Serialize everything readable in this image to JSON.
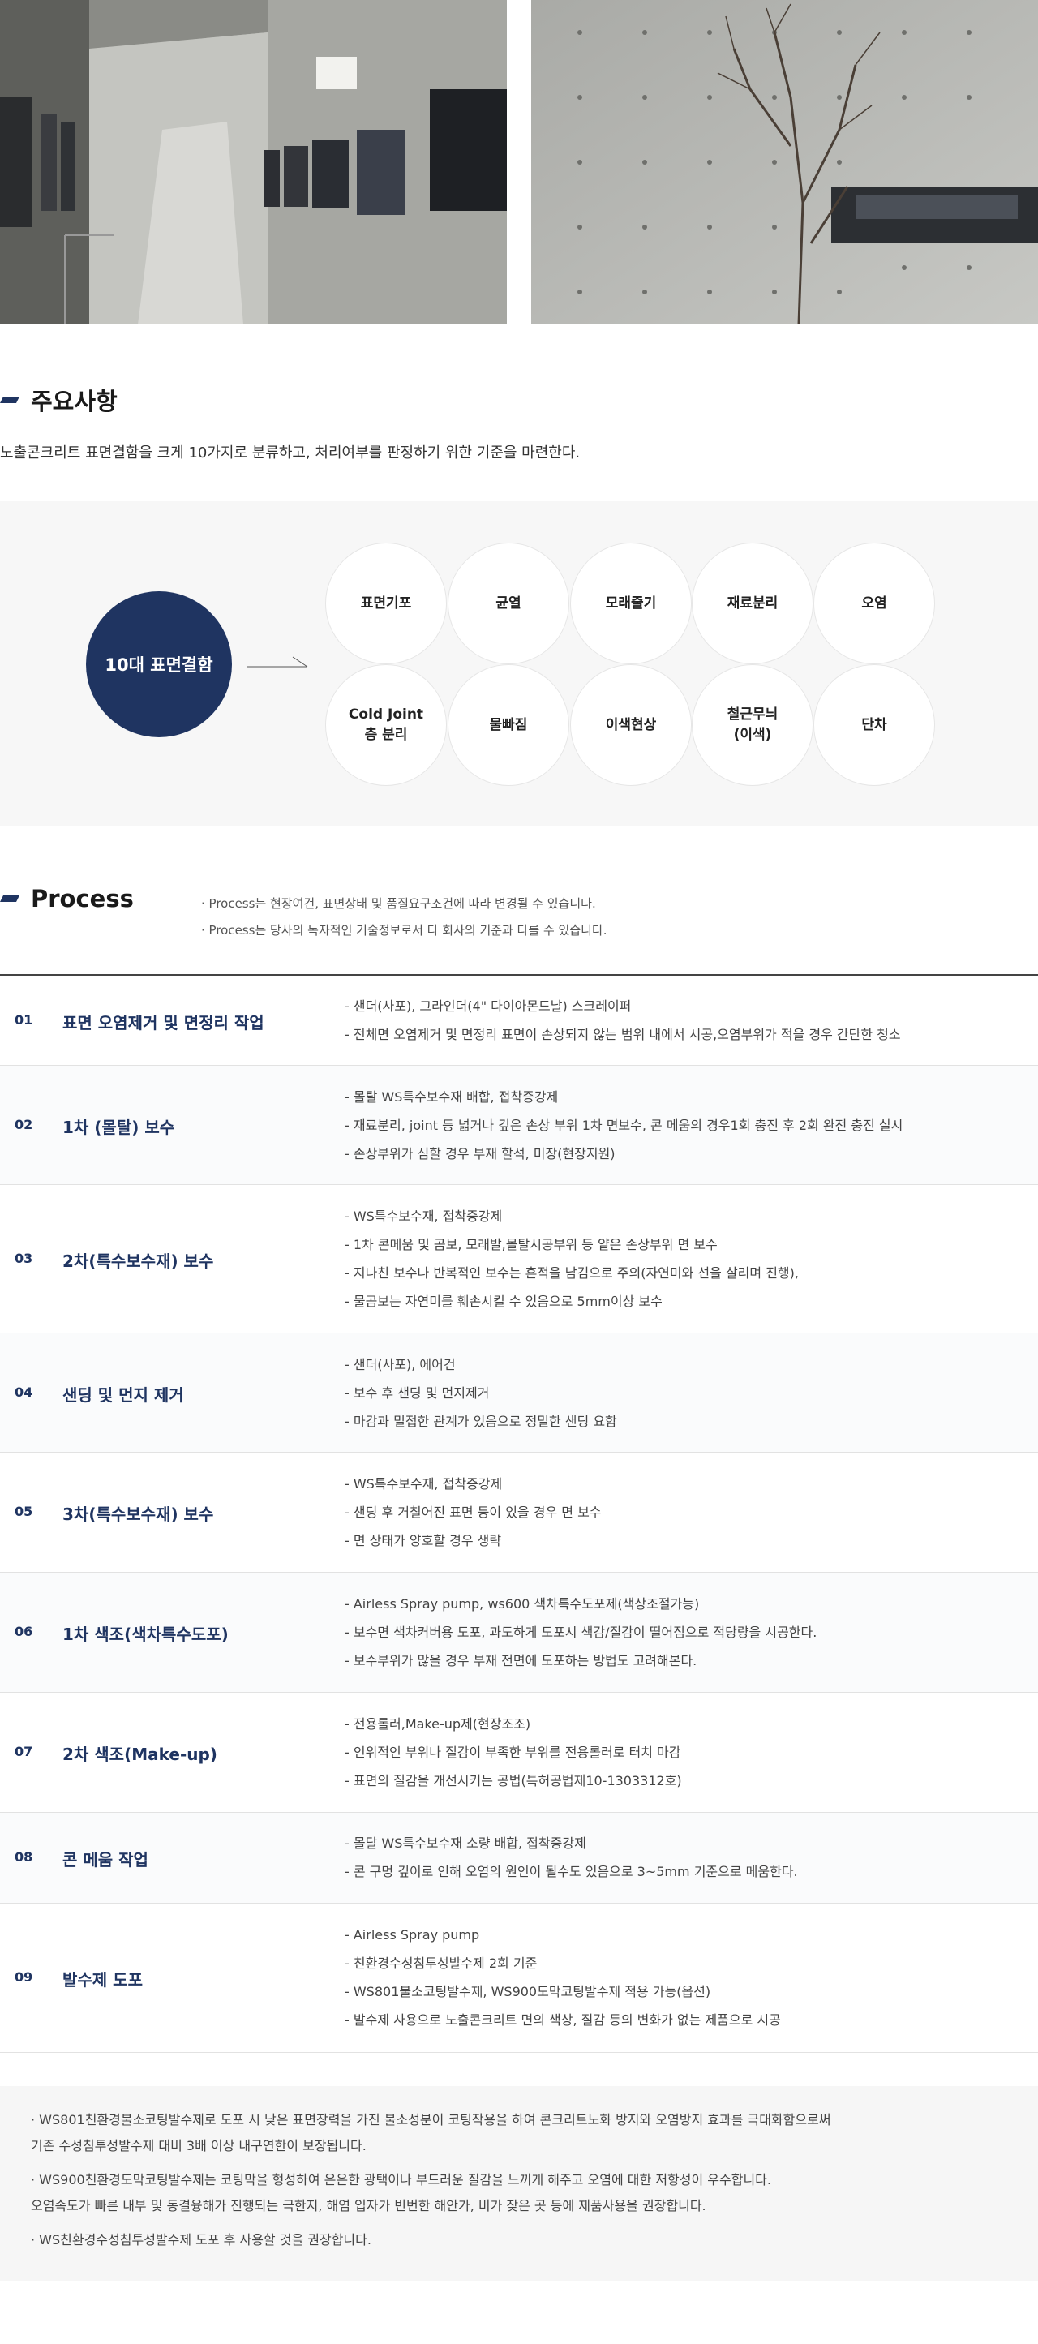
{
  "section1": {
    "title": "주요사항"
  },
  "intro": "노출콘크리트 표면결함을 크게 10가지로 분류하고, 처리여부를 판정하기 위한 기준을 마련한다.",
  "defects": {
    "center_label": "10대 표면결함",
    "items": [
      "표면기포",
      "균열",
      "모래줄기",
      "재료분리",
      "오염",
      "Cold Joint\n층 분리",
      "물빠짐",
      "이색현상",
      "철근무늬\n(이색)",
      "단차"
    ]
  },
  "section2": {
    "title": "Process",
    "notes": [
      "· Process는 현장여건, 표면상태 및 품질요구조건에 따라 변경될 수 있습니다.",
      "· Process는 당사의 독자적인 기술정보로서 타 회사의 기준과 다를 수 있습니다."
    ]
  },
  "process": [
    {
      "num": "01",
      "name": "표면 오염제거 및 면정리 작업",
      "desc": [
        "- 샌더(사포), 그라인더(4\" 다이아몬드날) 스크레이퍼",
        "- 전체면 오염제거 및 면정리 표면이 손상되지 않는 범위 내에서 시공,오염부위가 적을 경우 간단한 청소"
      ]
    },
    {
      "num": "02",
      "name": "1차 (몰탈) 보수",
      "desc": [
        "- 몰탈 WS특수보수재 배합, 접착증강제",
        "- 재료분리, joint 등 넓거나 깊은 손상 부위 1차 면보수, 콘 메움의 경우1회 충진 후 2회 완전 충진 실시",
        "- 손상부위가 심할 경우 부재 할석, 미장(현장지원)"
      ]
    },
    {
      "num": "03",
      "name": "2차(특수보수재) 보수",
      "desc": [
        "- WS특수보수재, 접착증강제",
        "- 1차 콘메움 및 곰보, 모래발,몰탈시공부위 등 얕은 손상부위 면 보수",
        "- 지나친 보수나 반복적인 보수는 흔적을 남김으로 주의(자연미와 선을 살리며 진행),",
        "- 물곰보는 자연미를 훼손시킬 수 있음으로 5mm이상 보수"
      ]
    },
    {
      "num": "04",
      "name": "샌딩 및 먼지 제거",
      "desc": [
        "- 샌더(사포), 에어건",
        "- 보수 후 샌딩 및 먼지제거",
        "- 마감과 밀접한 관계가 있음으로 정밀한 샌딩 요함"
      ]
    },
    {
      "num": "05",
      "name": "3차(특수보수재) 보수",
      "desc": [
        "-  WS특수보수재, 접착증강제",
        "-  샌딩 후 거칠어진 표면 등이  있을 경우 면 보수",
        "-  면 상태가 양호할 경우 생략"
      ]
    },
    {
      "num": "06",
      "name": "1차 색조(색차특수도포)",
      "desc": [
        "-  Airless Spray pump, ws600 색차특수도포제(색상조절가능)",
        "-  보수면 색차커버용 도포, 과도하게 도포시 색감/질감이 떨어짐으로 적당량을 시공한다.",
        "-  보수부위가 많을 경우 부재 전면에 도포하는 방법도 고려해본다."
      ]
    },
    {
      "num": "07",
      "name": "2차 색조(Make-up)",
      "desc": [
        "-  전용롤러,Make-up제(현장조조)",
        "-  인위적인 부위나 질감이 부족한 부위를 전용롤러로 터치 마감",
        "-  표면의 질감을 개선시키는 공법(특허공법제10-1303312호)"
      ]
    },
    {
      "num": "08",
      "name": "콘 메움 작업",
      "desc": [
        "- 몰탈 WS특수보수재 소량 배합, 접착증강제",
        "- 콘 구멍 깊이로 인해 오염의 원인이 될수도 있음으로 3~5mm 기준으로 메움한다."
      ]
    },
    {
      "num": "09",
      "name": "발수제 도포",
      "desc": [
        "- Airless Spray pump",
        "- 친환경수성침투성발수제 2회 기준",
        "- WS801불소코팅발수제, WS900도막코팅발수제 적용 가능(옵션)",
        "- 발수제 사용으로 노출콘크리트 면의 색상, 질감 등의 변화가 없는 제품으로 시공"
      ]
    }
  ],
  "bottom_notes": [
    [
      "· WS801친환경불소코팅발수제로 도포 시 낮은 표면장력을 가진 불소성분이 코팅작용을 하여 콘크리트노화 방지와 오염방지 효과를 극대화함으로써",
      "  기존 수성침투성발수제 대비 3배 이상 내구연한이 보장됩니다."
    ],
    [
      "· WS900친환경도막코팅발수제는 코팅막을 형성하여 은은한 광택이나 부드러운 질감을 느끼게 해주고 오염에 대한 저항성이 우수합니다.",
      "  오염속도가 빠른 내부 및 동결융해가 진행되는 극한지, 해염 입자가 빈번한 해안가, 비가 잦은 곳 등에 제품사용을 권장합니다."
    ],
    [
      "· WS친환경수성침투성발수제 도포 후 사용할 것을 권장합니다."
    ]
  ]
}
